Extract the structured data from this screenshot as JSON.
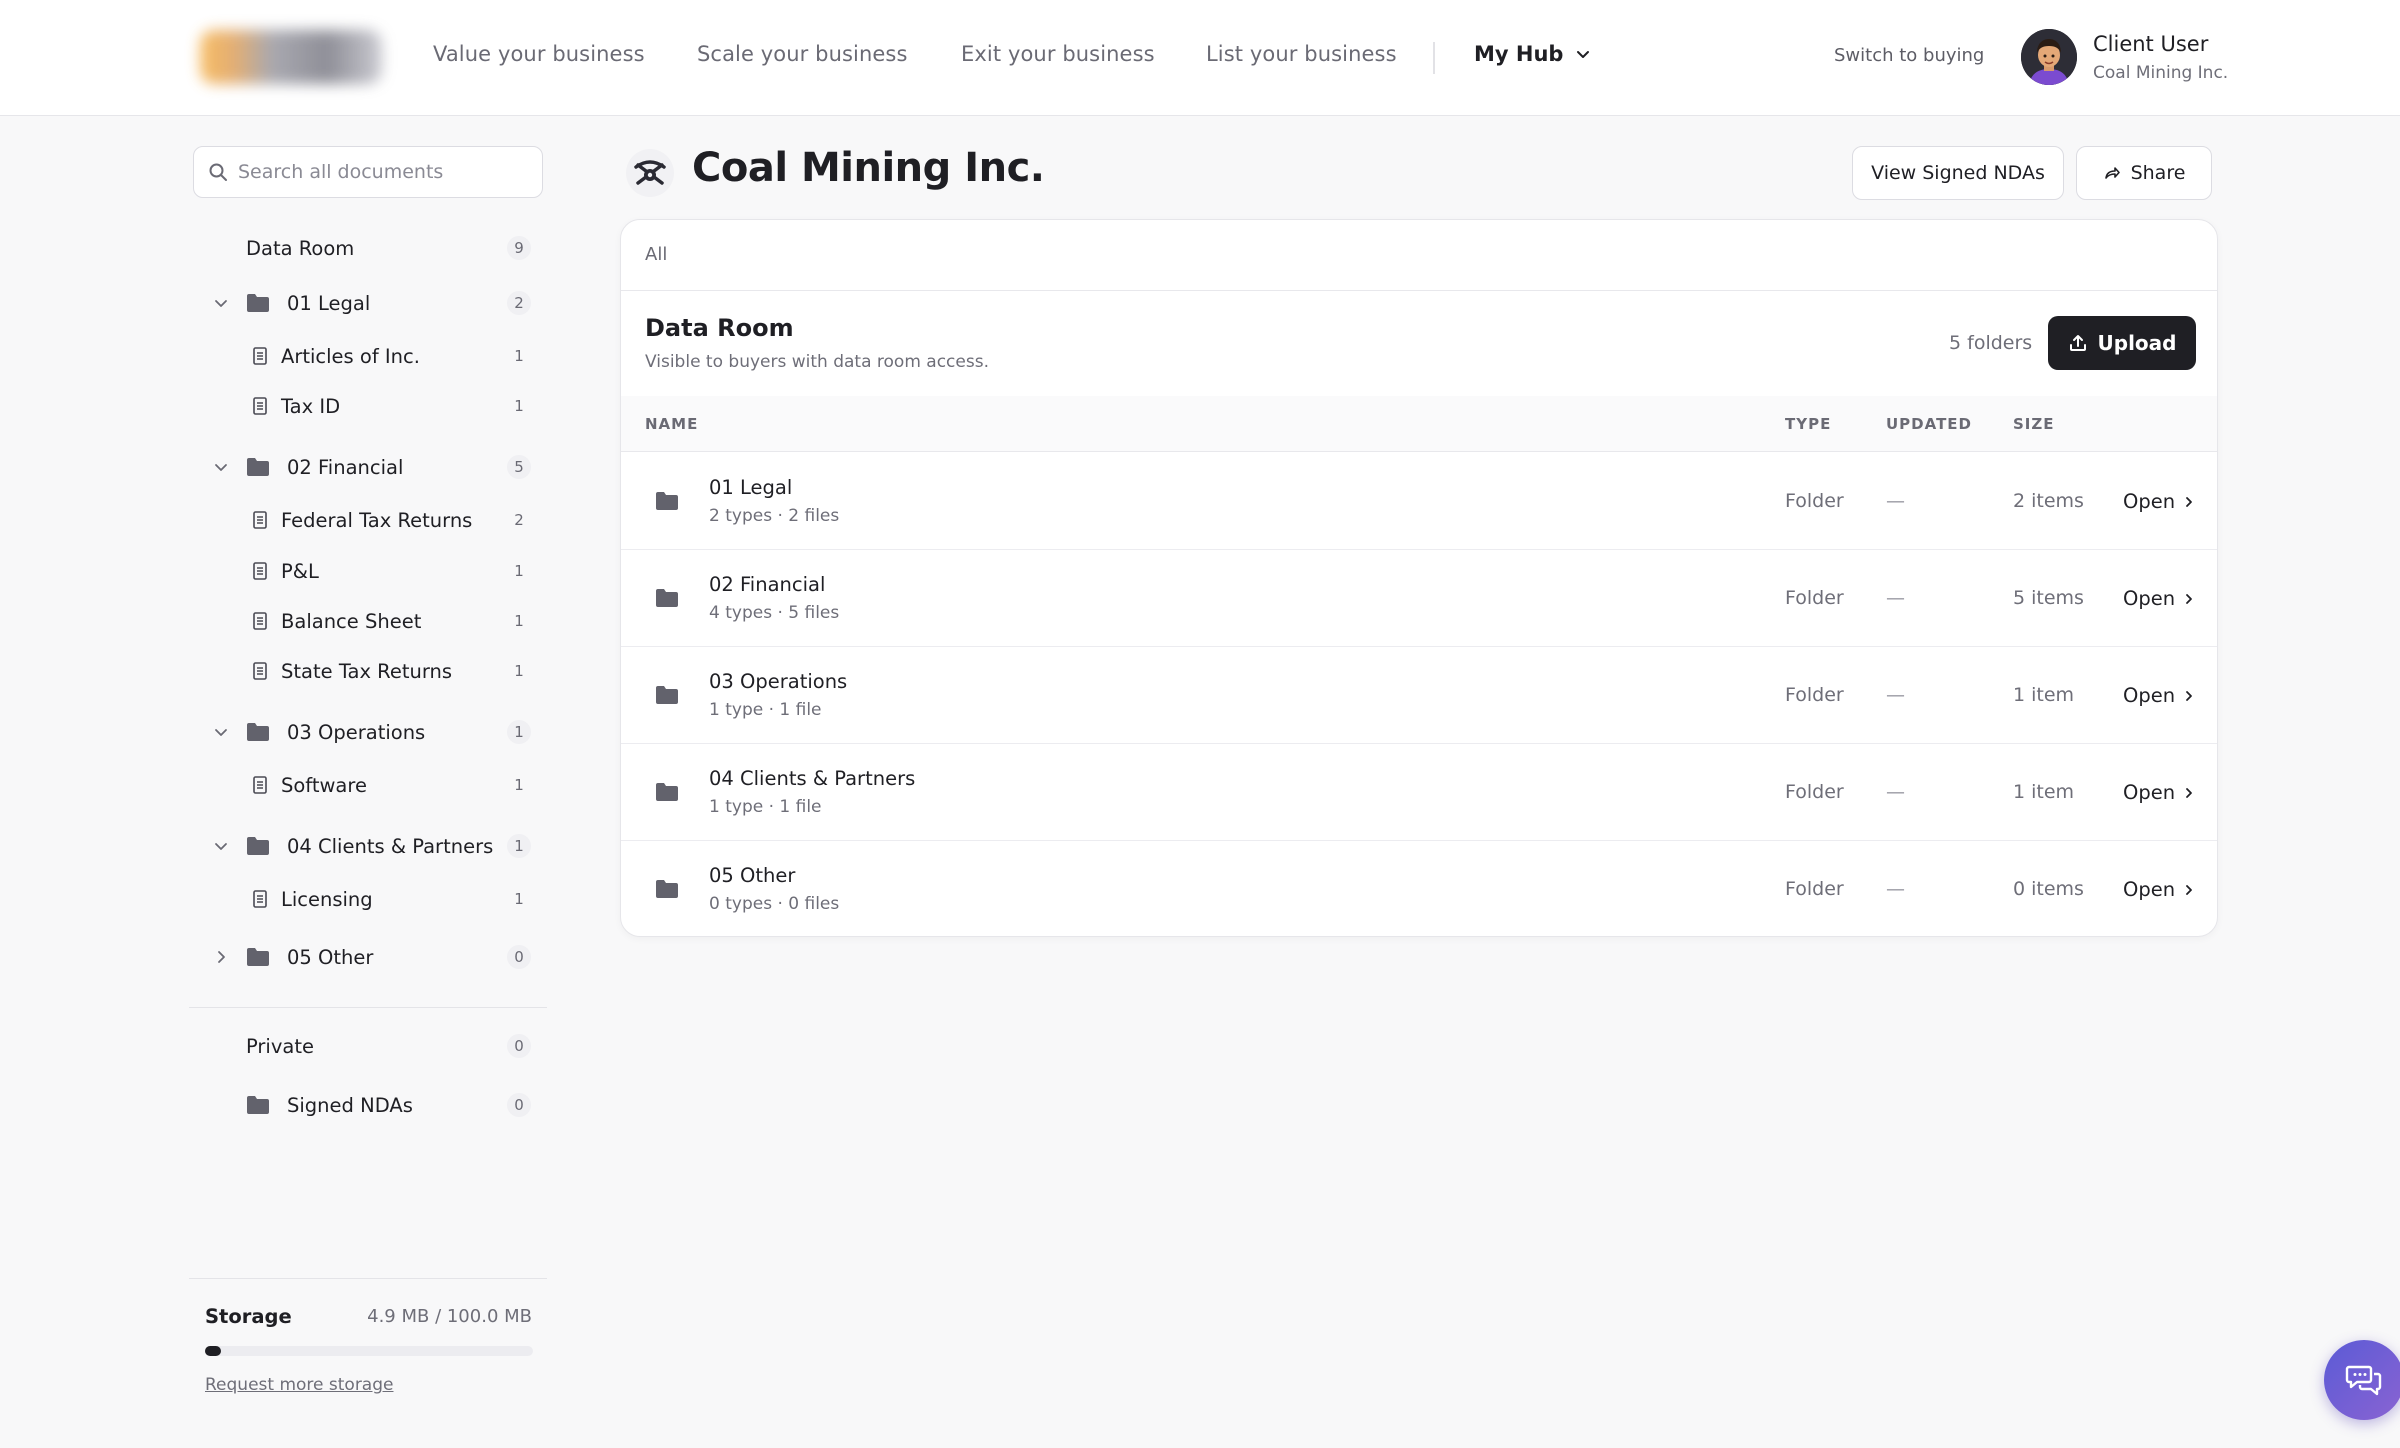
{
  "nav": {
    "links": [
      "Value your business",
      "Scale your business",
      "Exit your business",
      "List your business"
    ],
    "hub_label": "My Hub",
    "switch_label": "Switch to buying",
    "user_name": "Client User",
    "user_org": "Coal Mining Inc."
  },
  "sidebar": {
    "search_placeholder": "Search all documents",
    "data_room": {
      "label": "Data Room",
      "count": "9"
    },
    "folders": [
      {
        "label": "01 Legal",
        "count": "2",
        "expanded": true,
        "docs": [
          {
            "label": "Articles of Inc.",
            "count": "1"
          },
          {
            "label": "Tax ID",
            "count": "1"
          }
        ]
      },
      {
        "label": "02 Financial",
        "count": "5",
        "expanded": true,
        "docs": [
          {
            "label": "Federal Tax Returns",
            "count": "2"
          },
          {
            "label": "P&L",
            "count": "1"
          },
          {
            "label": "Balance Sheet",
            "count": "1"
          },
          {
            "label": "State Tax Returns",
            "count": "1"
          }
        ]
      },
      {
        "label": "03 Operations",
        "count": "1",
        "expanded": true,
        "docs": [
          {
            "label": "Software",
            "count": "1"
          }
        ]
      },
      {
        "label": "04 Clients & Partners",
        "count": "1",
        "expanded": true,
        "docs": [
          {
            "label": "Licensing",
            "count": "1"
          }
        ]
      },
      {
        "label": "05 Other",
        "count": "0",
        "expanded": false,
        "docs": []
      }
    ],
    "private": {
      "label": "Private",
      "count": "0"
    },
    "signed_ndas": {
      "label": "Signed NDAs",
      "count": "0"
    },
    "storage": {
      "label": "Storage",
      "value": "4.9 MB / 100.0 MB",
      "used_fraction": 0.049,
      "link": "Request more storage"
    }
  },
  "main": {
    "company": "Coal Mining Inc.",
    "view_ndas_label": "View Signed NDAs",
    "share_label": "Share",
    "filter_label": "All",
    "section_title": "Data Room",
    "section_subtitle": "Visible to buyers with data room access.",
    "folder_count": "5 folders",
    "upload_label": "Upload",
    "columns": [
      "NAME",
      "TYPE",
      "UPDATED",
      "SIZE"
    ],
    "rows": [
      {
        "name": "01 Legal",
        "meta": "2 types · 2 files",
        "type": "Folder",
        "updated": "—",
        "size": "2 items",
        "action": "Open"
      },
      {
        "name": "02 Financial",
        "meta": "4 types · 5 files",
        "type": "Folder",
        "updated": "—",
        "size": "5 items",
        "action": "Open"
      },
      {
        "name": "03 Operations",
        "meta": "1 type · 1 file",
        "type": "Folder",
        "updated": "—",
        "size": "1 item",
        "action": "Open"
      },
      {
        "name": "04 Clients & Partners",
        "meta": "1 type · 1 file",
        "type": "Folder",
        "updated": "—",
        "size": "1 item",
        "action": "Open"
      },
      {
        "name": "05 Other",
        "meta": "0 types · 0 files",
        "type": "Folder",
        "updated": "—",
        "size": "0 items",
        "action": "Open"
      }
    ]
  },
  "colors": {
    "accent": "#1f1f24",
    "folder": "#62626c",
    "chat_from": "#5b5bd6",
    "chat_to": "#8a63d2"
  }
}
